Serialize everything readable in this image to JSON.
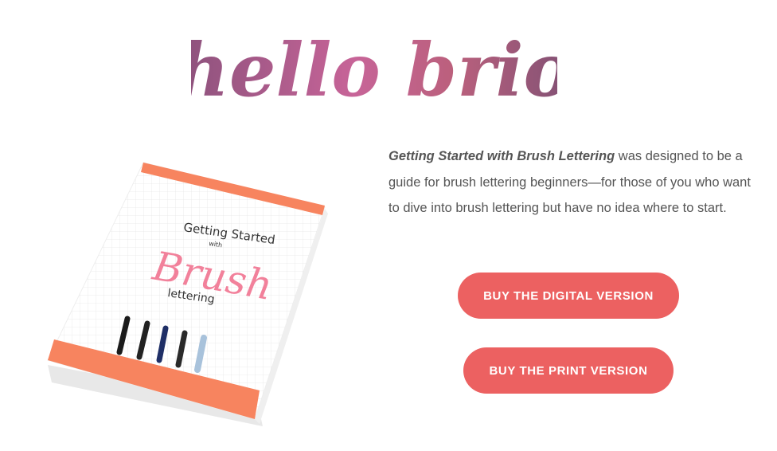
{
  "logo": {
    "text": "hello brio"
  },
  "book": {
    "title_line1": "Getting Started",
    "title_line2": "with",
    "title_line3": "Brush",
    "title_line4": "lettering"
  },
  "description": {
    "emphasis": "Getting Started with Brush Lettering",
    "rest": " was designed to be a guide for brush lettering beginners—for those of you who want to dive into brush lettering but have no idea where to start."
  },
  "buttons": {
    "digital": "BUY THE DIGITAL VERSION",
    "print": "BUY THE PRINT VERSION"
  },
  "colors": {
    "accent": "#ec6161",
    "book_band": "#f7845f",
    "logo": "#8a3a6c"
  }
}
